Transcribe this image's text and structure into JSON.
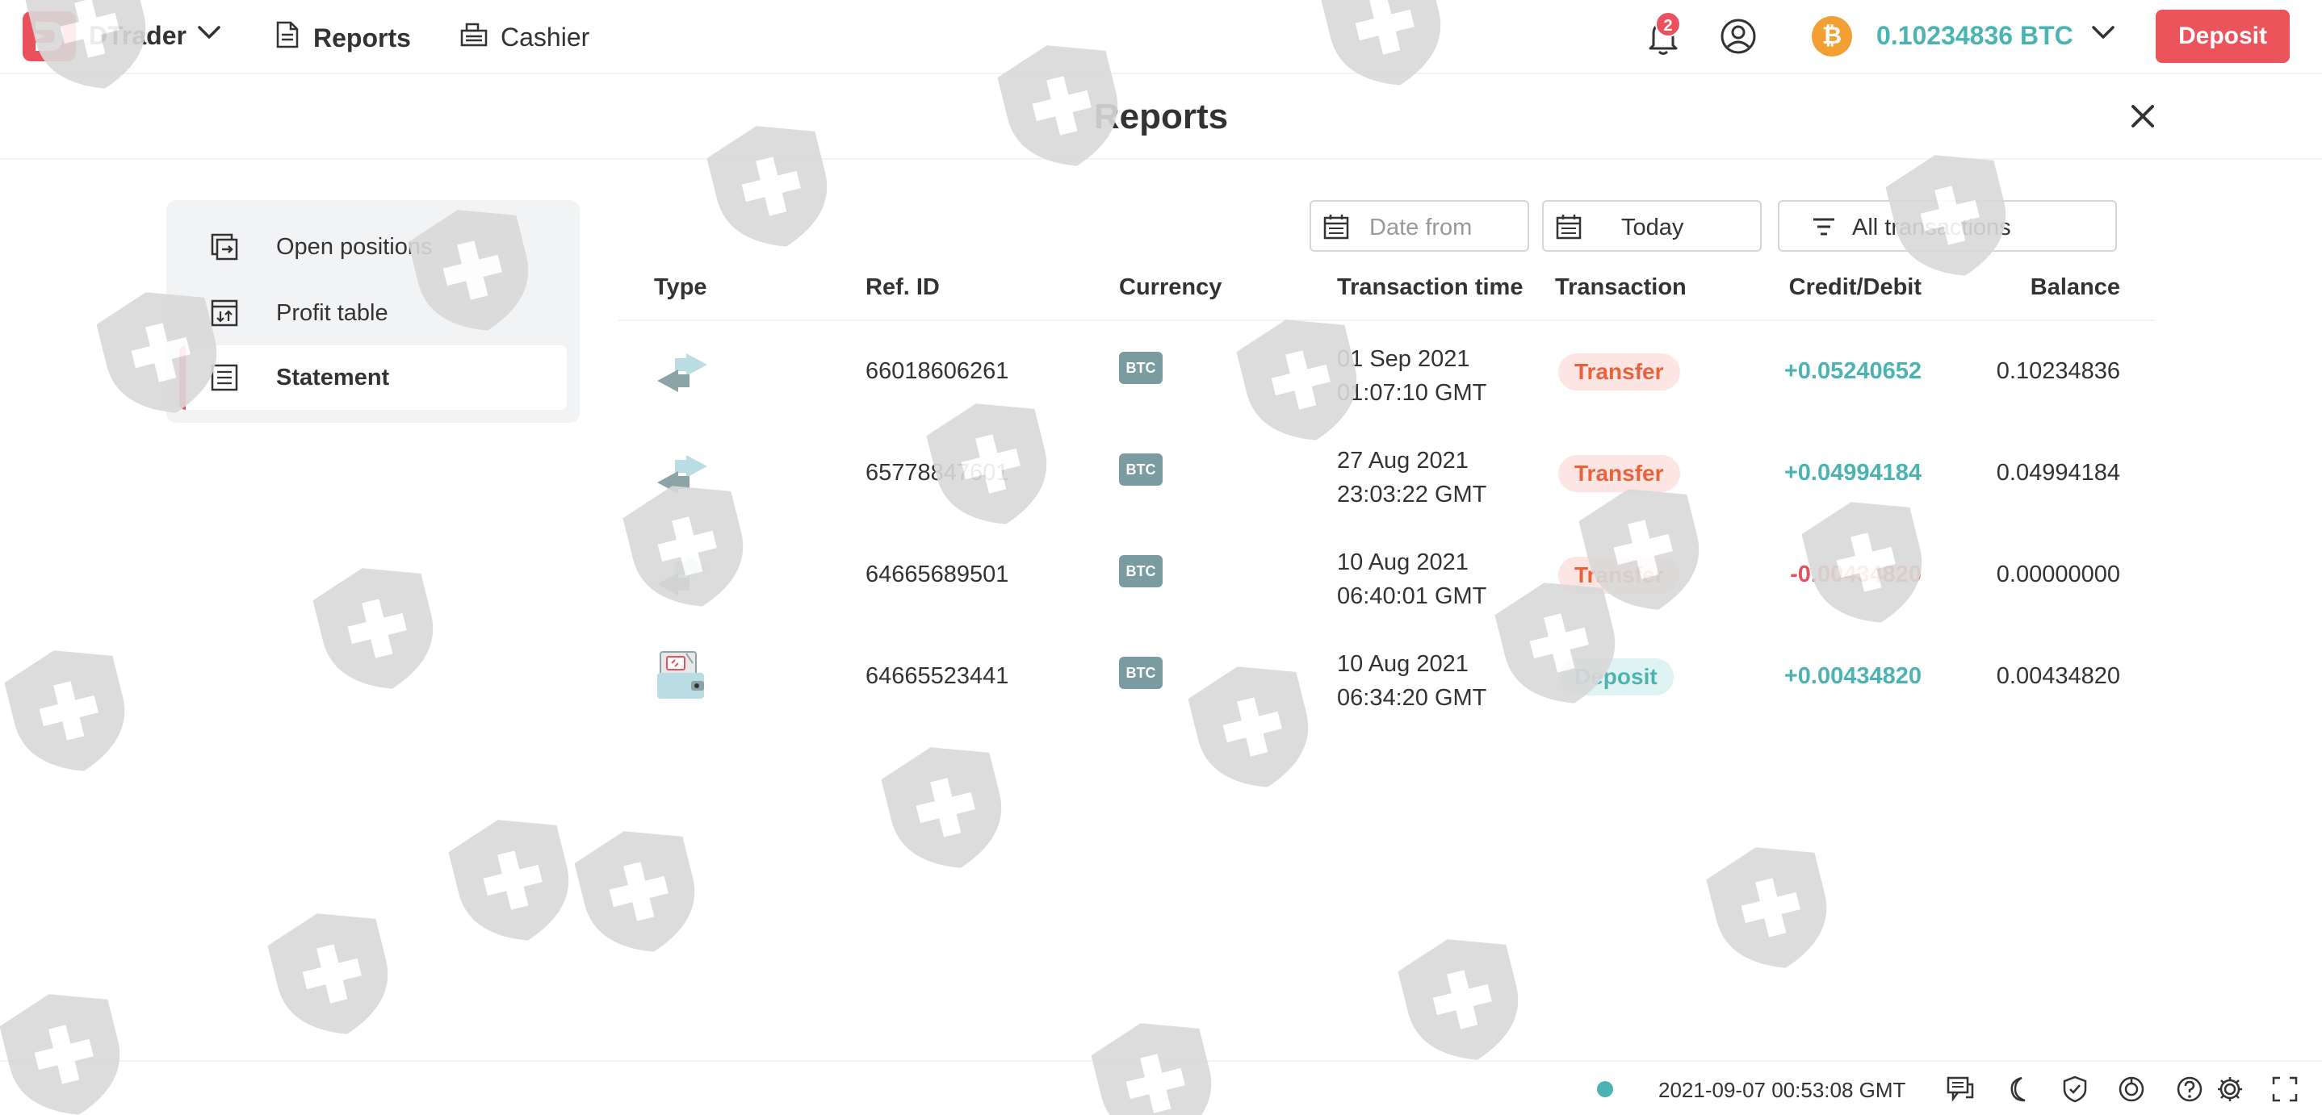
{
  "header": {
    "brand": "DTrader",
    "nav": {
      "reports": "Reports",
      "cashier": "Cashier"
    },
    "notifications_count": "2",
    "currency_symbol": "₿",
    "balance": "0.10234836 BTC",
    "deposit_label": "Deposit"
  },
  "title_bar": {
    "title": "Reports"
  },
  "sidebar": {
    "items": [
      {
        "label": "Open positions",
        "icon": "open-positions-icon",
        "active": false
      },
      {
        "label": "Profit table",
        "icon": "profit-table-icon",
        "active": false
      },
      {
        "label": "Statement",
        "icon": "statement-icon",
        "active": true
      }
    ]
  },
  "filters": {
    "date_from_placeholder": "Date from",
    "date_to": "Today",
    "transaction_filter": "All transactions"
  },
  "table": {
    "columns": [
      "Type",
      "Ref. ID",
      "Currency",
      "Transaction time",
      "Transaction",
      "Credit/Debit",
      "Balance"
    ],
    "rows": [
      {
        "type_icon": "transfer-icon",
        "ref_id": "66018606261",
        "currency": "BTC",
        "date": "01 Sep 2021",
        "time": "01:07:10 GMT",
        "transaction": "Transfer",
        "amount": "+0.05240652",
        "balance": "0.10234836"
      },
      {
        "type_icon": "transfer-icon",
        "ref_id": "65778847601",
        "currency": "BTC",
        "date": "27 Aug 2021",
        "time": "23:03:22 GMT",
        "transaction": "Transfer",
        "amount": "+0.04994184",
        "balance": "0.04994184"
      },
      {
        "type_icon": "transfer-icon",
        "ref_id": "64665689501",
        "currency": "BTC",
        "date": "10 Aug 2021",
        "time": "06:40:01 GMT",
        "transaction": "Transfer",
        "amount": "-0.00434820",
        "balance": "0.00000000"
      },
      {
        "type_icon": "deposit-icon",
        "ref_id": "64665523441",
        "currency": "BTC",
        "date": "10 Aug 2021",
        "time": "06:34:20 GMT",
        "transaction": "Deposit",
        "amount": "+0.00434820",
        "balance": "0.00434820"
      }
    ]
  },
  "footer": {
    "server_time": "2021-09-07 00:53:08 GMT",
    "icons": [
      "chat-icon",
      "theme-moon-icon",
      "shield-icon",
      "responsible-trading-icon",
      "help-icon",
      "settings-icon",
      "fullscreen-icon"
    ]
  },
  "colors": {
    "brand_red": "#e9525c",
    "positive": "#4bb4b3",
    "negative": "#e9525c",
    "btc_orange": "#f2a033"
  }
}
